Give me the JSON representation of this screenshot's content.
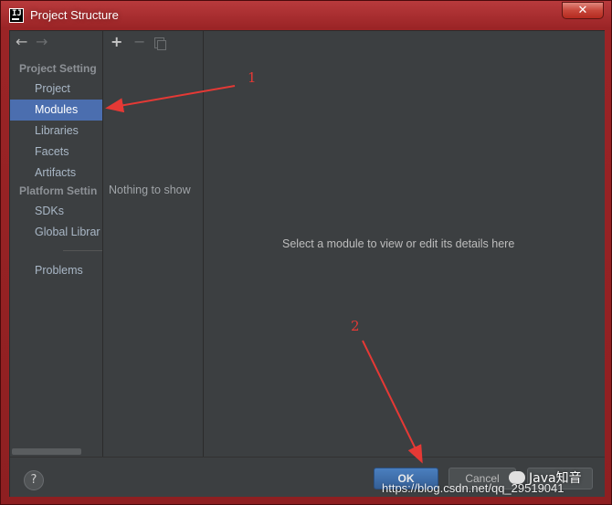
{
  "window": {
    "title": "Project Structure",
    "app_icon_text": "IJ",
    "close_glyph": "✕"
  },
  "nav": {
    "back_glyph": "←",
    "forward_glyph": "→",
    "project_settings_header": "Project Setting",
    "items_project": [
      {
        "label": "Project"
      },
      {
        "label": "Modules",
        "selected": true
      },
      {
        "label": "Libraries"
      },
      {
        "label": "Facets"
      },
      {
        "label": "Artifacts"
      }
    ],
    "platform_settings_header": "Platform Settin",
    "items_platform": [
      {
        "label": "SDKs"
      },
      {
        "label": "Global Librar"
      }
    ],
    "problems_label": "Problems"
  },
  "list": {
    "add_glyph": "+",
    "remove_glyph": "−",
    "empty_text": "Nothing to show"
  },
  "details": {
    "message": "Select a module to view or edit its details here"
  },
  "footer": {
    "help_glyph": "?",
    "ok_label": "OK",
    "cancel_label": "Cancel"
  },
  "annotations": {
    "step1": "1",
    "step2": "2"
  },
  "watermark": {
    "url": "https://blog.csdn.net/qq_29519041",
    "brand": "Java知音"
  },
  "colors": {
    "selection": "#4b6eaf",
    "panel_bg": "#3c3f41",
    "annotation": "#e53935",
    "title_bar": "#9b2426"
  }
}
